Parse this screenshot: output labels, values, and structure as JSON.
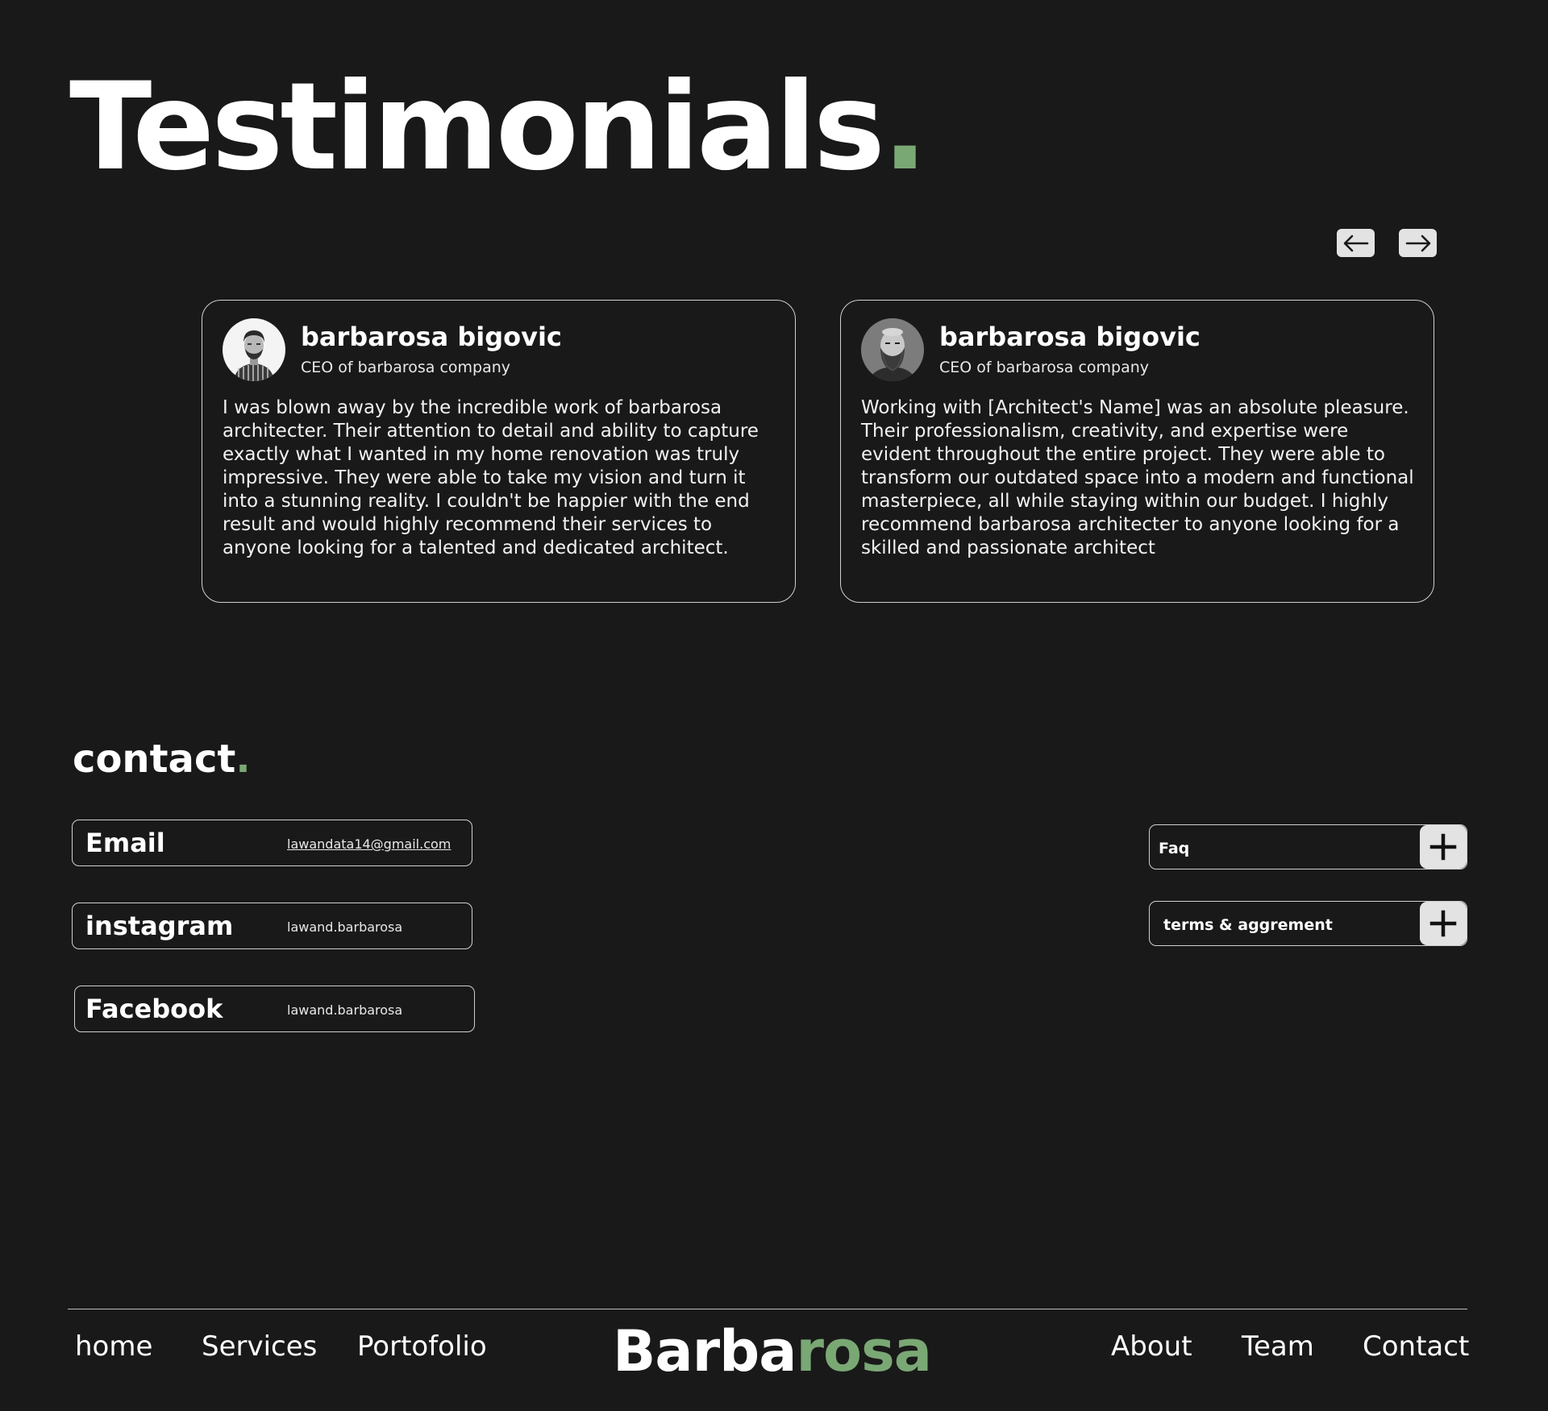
{
  "heading": {
    "text": "Testimonials",
    "dot": "."
  },
  "carousel": {
    "prev_icon": "arrow-left-icon",
    "next_icon": "arrow-right-icon"
  },
  "testimonials": [
    {
      "name": "barbarosa bigovic",
      "role": "CEO of barbarosa company",
      "quote": "I was blown away by the incredible work of barbarosa architecter. Their attention to detail and ability to capture exactly what I wanted in my home renovation was truly impressive. They were able to take my vision and turn it into a stunning reality. I couldn't be happier with the end result and would highly recommend their services to anyone looking for a talented and dedicated architect."
    },
    {
      "name": "barbarosa bigovic",
      "role": "CEO of barbarosa company",
      "quote": "Working with [Architect's Name] was an absolute pleasure. Their professionalism, creativity, and expertise were evident throughout the entire project. They were able to transform our outdated space into a modern and functional masterpiece, all while staying within our budget. I highly recommend barbarosa architecter to anyone looking for a skilled and passionate architect"
    }
  ],
  "contact": {
    "title": "contact",
    "dot": ".",
    "items": [
      {
        "label": "Email",
        "value": "lawandata14@gmail.com"
      },
      {
        "label": "instagram",
        "value": "lawand.barbarosa"
      },
      {
        "label": "Facebook",
        "value": "lawand.barbarosa"
      }
    ]
  },
  "accordion": [
    {
      "label": "Faq",
      "icon": "plus-icon"
    },
    {
      "label": "terms & aggrement",
      "icon": "plus-icon"
    }
  ],
  "footer": {
    "nav_left": [
      "home",
      "Services",
      "Portofolio"
    ],
    "brand_a": "Barba",
    "brand_b": "rosa",
    "nav_right": [
      "About",
      "Team",
      "Contact"
    ]
  },
  "colors": {
    "background": "#191919",
    "accent": "#7aa874",
    "text": "#ffffff"
  }
}
